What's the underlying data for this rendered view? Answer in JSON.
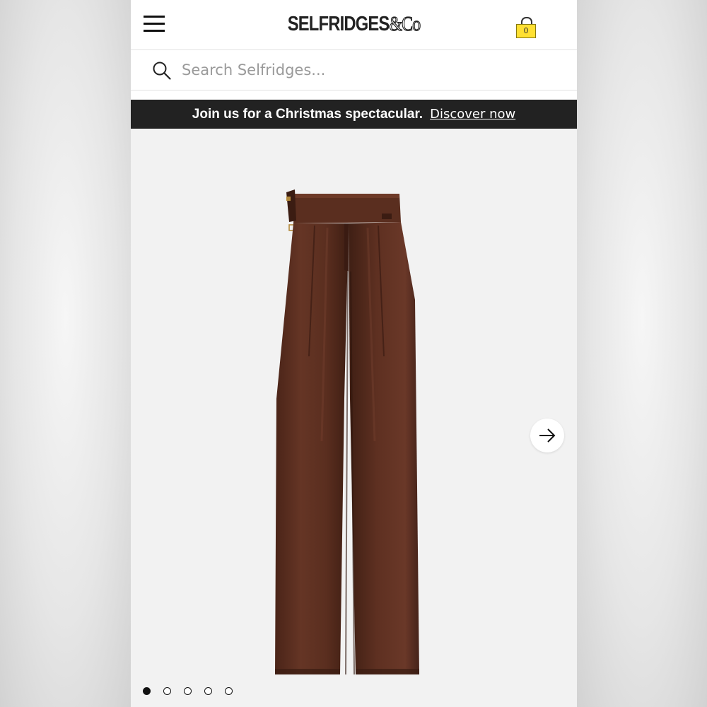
{
  "header": {
    "logo_text": "SELFRIDGES",
    "logo_suffix": "&Co",
    "bag_count": "0"
  },
  "search": {
    "placeholder": "Search Selfridges..."
  },
  "promo": {
    "text": "Join us for a Christmas spectacular.",
    "link_label": "Discover now"
  },
  "gallery": {
    "image_count": 5,
    "active_index": 0
  },
  "colors": {
    "promo_background": "#222222",
    "bag_yellow": "#ffe033",
    "product_brown": "#5a2f1f"
  },
  "icons": {
    "menu": "hamburger-menu-icon",
    "bag": "shopping-bag-icon",
    "search": "search-icon",
    "next": "arrow-right-icon"
  }
}
